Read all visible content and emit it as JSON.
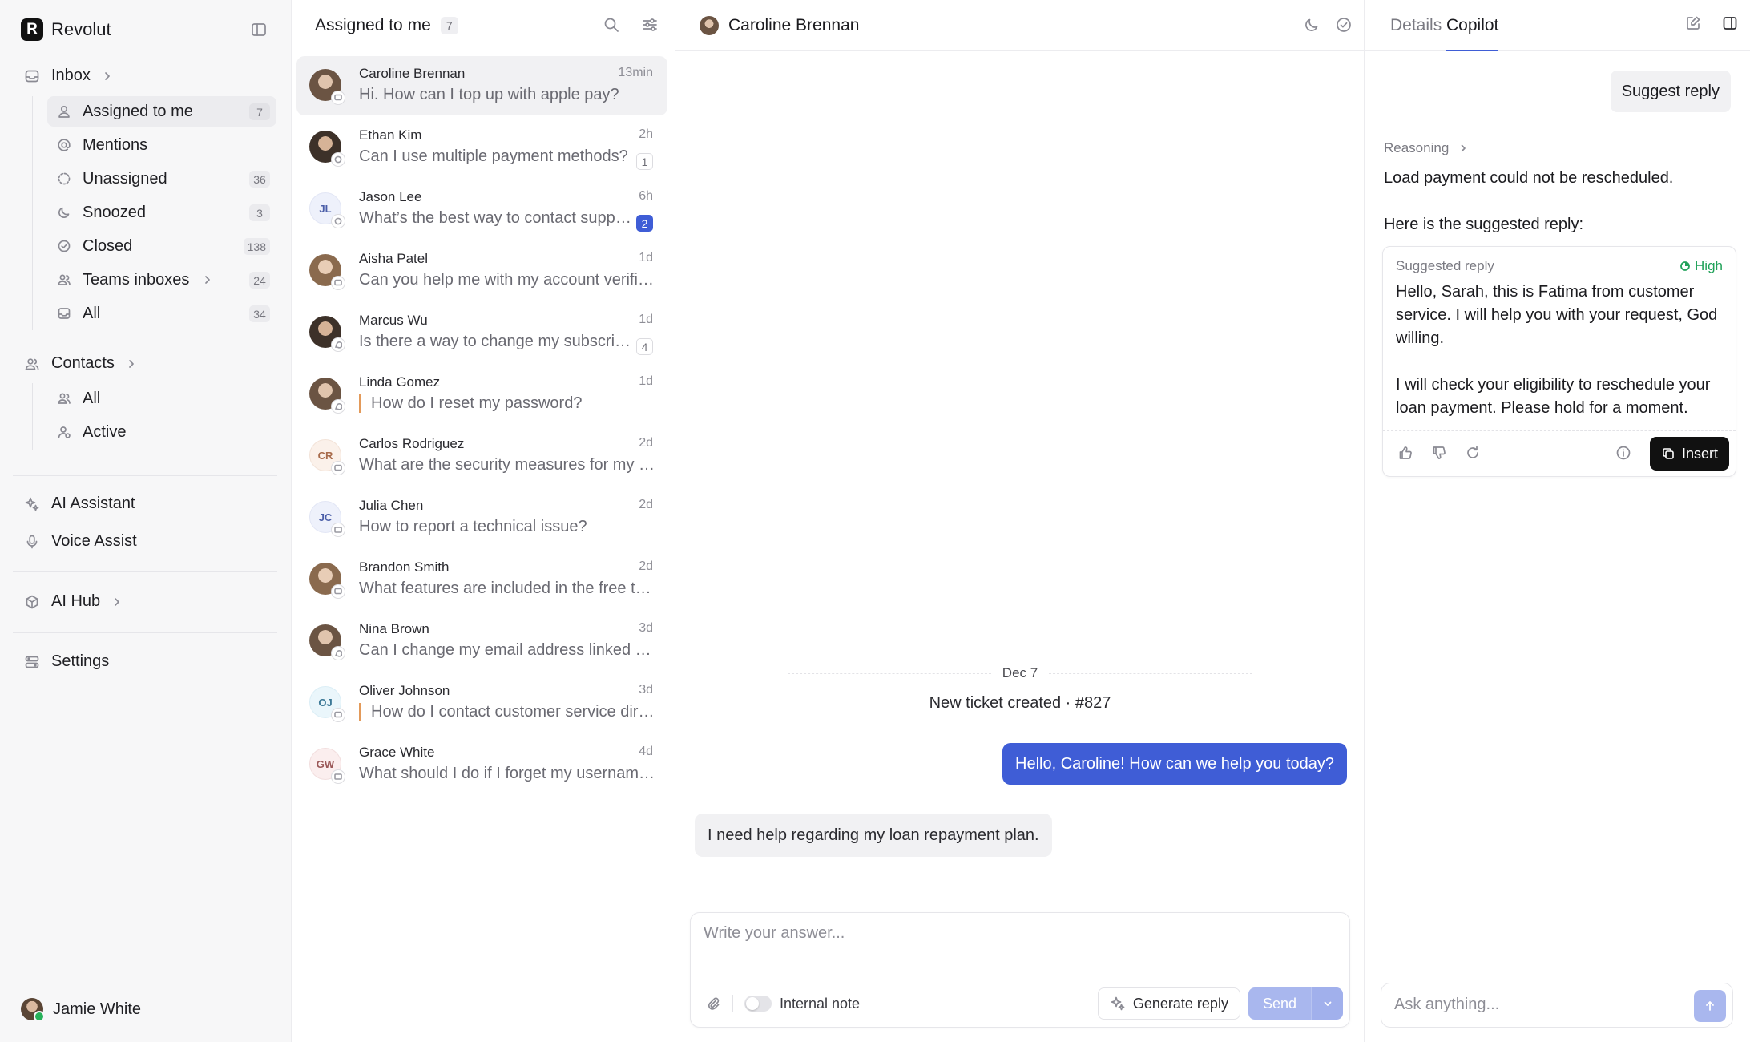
{
  "brand": {
    "name": "Revolut",
    "logo_letter": "R"
  },
  "sidebar": {
    "inbox_label": "Inbox",
    "inbox_items": [
      {
        "label": "Assigned to me",
        "count": "7",
        "icon": "user-icon"
      },
      {
        "label": "Mentions",
        "count": "",
        "icon": "at-icon"
      },
      {
        "label": "Unassigned",
        "count": "36",
        "icon": "dashed-circle-icon"
      },
      {
        "label": "Snoozed",
        "count": "3",
        "icon": "moon-icon"
      },
      {
        "label": "Closed",
        "count": "138",
        "icon": "check-circle-icon"
      },
      {
        "label": "Teams inboxes",
        "count": "24",
        "icon": "users-icon"
      },
      {
        "label": "All",
        "count": "34",
        "icon": "inbox-icon"
      }
    ],
    "contacts_label": "Contacts",
    "contacts_items": [
      {
        "label": "All",
        "icon": "users-icon"
      },
      {
        "label": "Active",
        "icon": "user-active-icon"
      }
    ],
    "ai_assistant_label": "AI Assistant",
    "voice_assist_label": "Voice Assist",
    "ai_hub_label": "AI Hub",
    "settings_label": "Settings",
    "user_name": "Jamie White"
  },
  "list": {
    "title": "Assigned to me",
    "count": "7",
    "conversations": [
      {
        "name": "Caroline Brennan",
        "time": "13min",
        "preview": "Hi. How can I top up with apple pay?",
        "badge": "",
        "initials": ""
      },
      {
        "name": "Ethan Kim",
        "time": "2h",
        "preview": "Can I use multiple payment methods?",
        "badge": "1",
        "initials": ""
      },
      {
        "name": "Jason Lee",
        "time": "6h",
        "preview": "What’s the best way to contact support?",
        "badge": "2",
        "initials": "JL"
      },
      {
        "name": "Aisha Patel",
        "time": "1d",
        "preview": "Can you help me with my account verification?",
        "badge": "",
        "initials": ""
      },
      {
        "name": "Marcus Wu",
        "time": "1d",
        "preview": "Is there a way to change my subscription?",
        "badge": "4",
        "initials": ""
      },
      {
        "name": "Linda Gomez",
        "time": "1d",
        "preview": "How do I reset my password?",
        "badge": "",
        "initials": ""
      },
      {
        "name": "Carlos Rodriguez",
        "time": "2d",
        "preview": "What are the security measures for my data?",
        "badge": "",
        "initials": "CR"
      },
      {
        "name": "Julia Chen",
        "time": "2d",
        "preview": "How to report a technical issue?",
        "badge": "",
        "initials": "JC"
      },
      {
        "name": "Brandon Smith",
        "time": "2d",
        "preview": "What features are included in the free trial?",
        "badge": "",
        "initials": ""
      },
      {
        "name": "Nina Brown",
        "time": "3d",
        "preview": "Can I change my email address linked to my account?",
        "badge": "",
        "initials": ""
      },
      {
        "name": "Oliver Johnson",
        "time": "3d",
        "preview": "How do I contact customer service directly?",
        "badge": "",
        "initials": "OJ"
      },
      {
        "name": "Grace White",
        "time": "4d",
        "preview": "What should I do if I forget my username?",
        "badge": "",
        "initials": "GW"
      }
    ]
  },
  "chat": {
    "contact_name": "Caroline Brennan",
    "date_label": "Dec 7",
    "ticket_event": "New ticket created · #827",
    "agent_message": "Hello, Caroline! How can we help you today?",
    "customer_message": "I need help regarding my loan repayment plan.",
    "composer_placeholder": "Write your answer...",
    "internal_note_label": "Internal note",
    "generate_reply_label": "Generate reply",
    "send_label": "Send"
  },
  "copilot": {
    "tabs": [
      "Details",
      "Copilot"
    ],
    "suggest_reply_chip": "Suggest reply",
    "reasoning_label": "Reasoning",
    "reasoning_text": "Load payment could not be rescheduled.",
    "intro_text": "Here is the suggested reply:",
    "card_title": "Suggested reply",
    "confidence": "High",
    "reply_paragraph_1": "Hello, Sarah, this is Fatima from customer service. I will help you with your request, God willing.",
    "reply_paragraph_2": "I will check your eligibility to reschedule your loan payment. Please hold for a moment.",
    "insert_label": "Insert",
    "ask_placeholder": "Ask anything..."
  },
  "colors": {
    "accent": "#3f5dd6",
    "send_disabled": "#a9b7ee",
    "confidence_green": "#22a25a",
    "note_marker": "#e39a5a"
  }
}
